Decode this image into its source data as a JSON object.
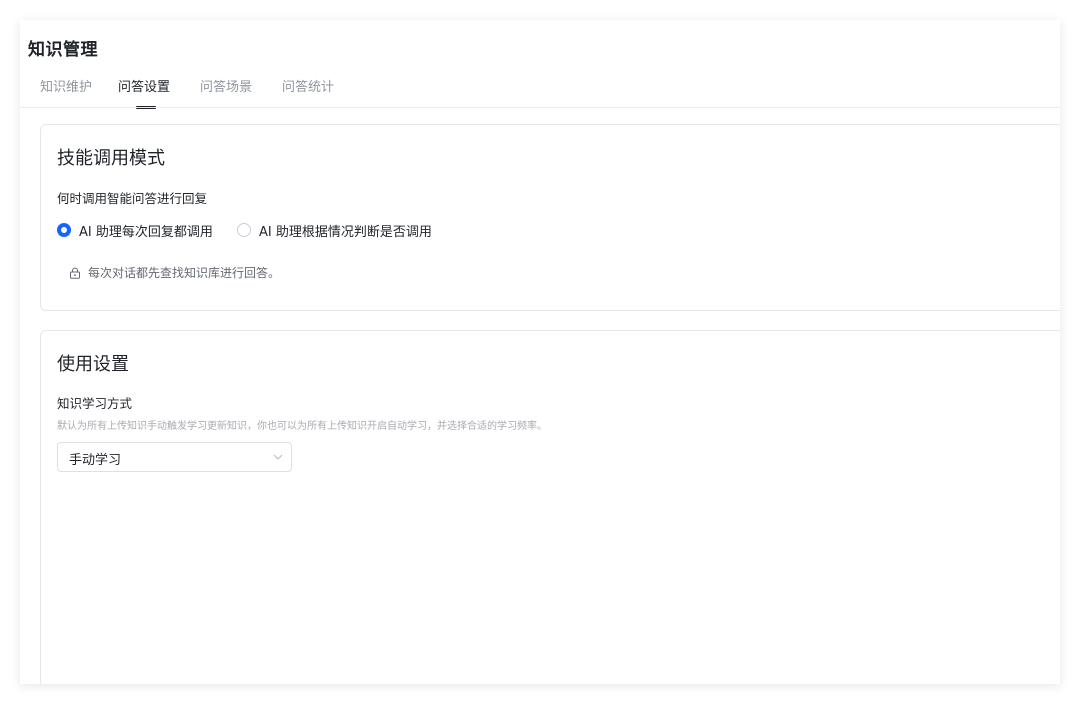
{
  "page": {
    "title": "知识管理"
  },
  "tabs": [
    {
      "label": "知识维护",
      "active": false
    },
    {
      "label": "问答设置",
      "active": true
    },
    {
      "label": "问答场景",
      "active": false
    },
    {
      "label": "问答统计",
      "active": false
    }
  ],
  "skill_mode": {
    "title": "技能调用模式",
    "question": "何时调用智能问答进行回复",
    "options": [
      {
        "label": "AI 助理每次回复都调用",
        "selected": true
      },
      {
        "label": "AI 助理根据情况判断是否调用",
        "selected": false
      }
    ],
    "hint": "每次对话都先查找知识库进行回答。",
    "hint_icon": "lock-icon"
  },
  "usage": {
    "title": "使用设置",
    "learning_label": "知识学习方式",
    "learning_desc": "默认为所有上传知识手动触发学习更新知识，你也可以为所有上传知识开启自动学习，并选择合适的学习频率。",
    "learning_value": "手动学习",
    "select_icon": "chevron-down-icon"
  },
  "colors": {
    "accent": "#1664ff",
    "text_primary": "#1f2329",
    "text_secondary": "#8f959e"
  }
}
